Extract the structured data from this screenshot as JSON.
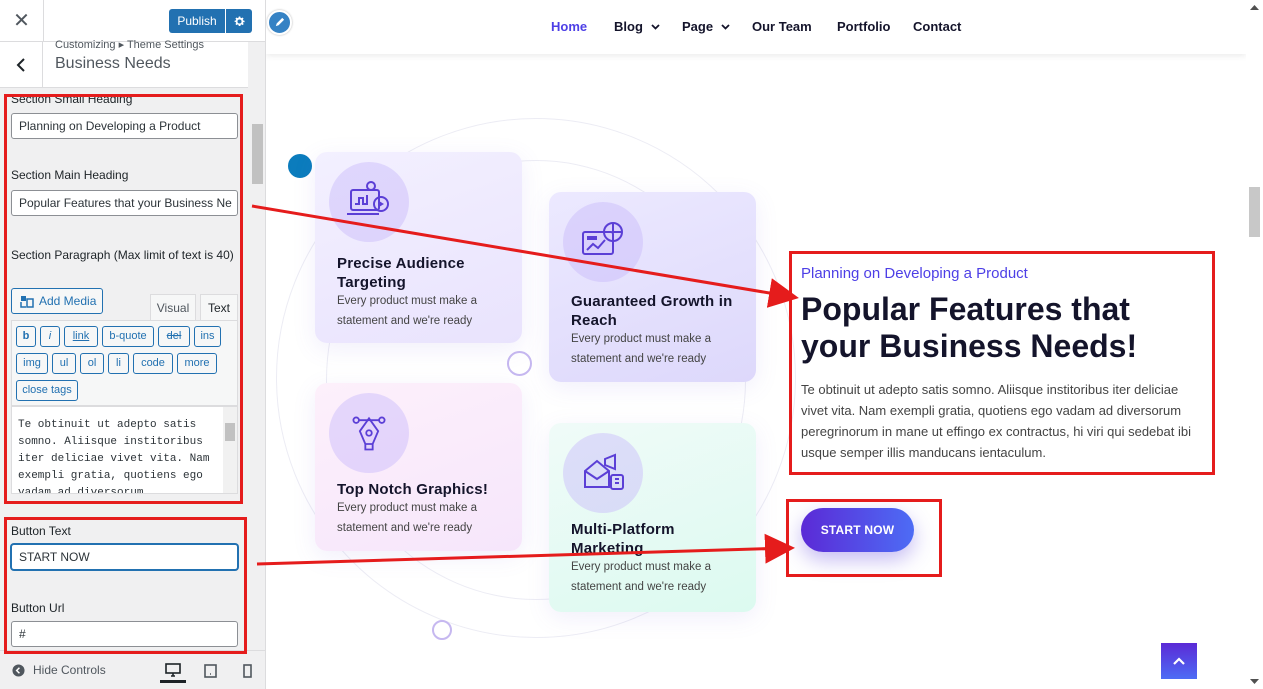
{
  "customizer": {
    "publish_label": "Publish",
    "breadcrumb": "Customizing ▸ Theme Settings",
    "section_title": "Business Needs",
    "controls": {
      "small_heading_label": "Section Small Heading",
      "small_heading_value": "Planning on Developing a Product",
      "main_heading_label": "Section Main Heading",
      "main_heading_value": "Popular Features that your Business Ne",
      "paragraph_label": "Section Paragraph (Max limit of text is 40)",
      "add_media_label": "Add Media",
      "tab_visual": "Visual",
      "tab_text": "Text",
      "quicktags": [
        "b",
        "i",
        "link",
        "b-quote",
        "del",
        "ins",
        "img",
        "ul",
        "ol",
        "li",
        "code",
        "more",
        "close tags"
      ],
      "editor_text": "Te obtinuit ut adepto satis somno. Aliisque institoribus iter deliciae vivet vita. Nam exempli gratia, quotiens ego vadam ad diversorum",
      "button_text_label": "Button Text",
      "button_text_value": "START NOW",
      "button_url_label": "Button Url",
      "button_url_value": "#"
    },
    "footer": {
      "hide_controls": "Hide Controls"
    }
  },
  "preview": {
    "nav": [
      "Home",
      "Blog",
      "Page",
      "Our Team",
      "Portfolio",
      "Contact"
    ],
    "cards": [
      {
        "title": "Precise Audience Targeting",
        "desc": "Every product must make a statement and we're ready"
      },
      {
        "title": "Guaranteed Growth in Reach",
        "desc": "Every product must make a statement and we're ready"
      },
      {
        "title": "Top Notch Graphics!",
        "desc": "Every product must make a statement and we're ready"
      },
      {
        "title": "Multi-Platform Marketing",
        "desc": "Every product must make a statement and we're ready"
      }
    ],
    "small_heading": "Planning on Developing a Product",
    "main_heading": "Popular Features that your Business Needs!",
    "paragraph": "Te obtinuit ut adepto satis somno. Aliisque institoribus iter deliciae vivet vita. Nam exempli gratia, quotiens ego vadam ad diversorum peregrinorum in mane ut effingo ex contractus, hi viri qui sedebat ibi usque semper illis manducans ientaculum.",
    "button_label": "START NOW"
  },
  "colors": {
    "accent": "#4d3fe6",
    "wp_blue": "#2271b1",
    "annotation_red": "#e51c1c"
  }
}
